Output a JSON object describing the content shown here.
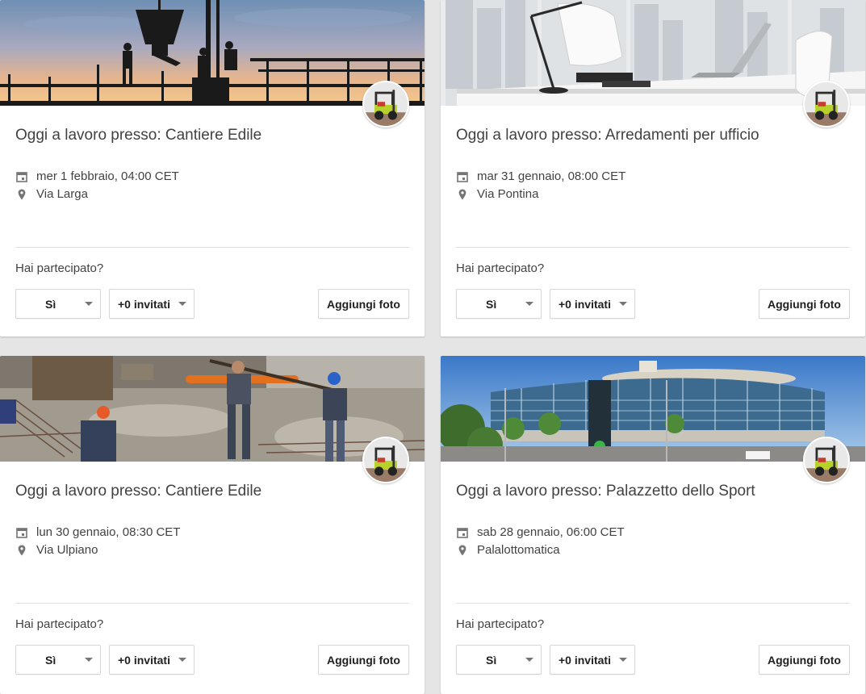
{
  "events": [
    {
      "title": "Oggi a lavoro presso: Cantiere Edile",
      "date": "mer 1 febbraio, 04:00 CET",
      "place": "Via Larga",
      "question": "Hai partecipato?",
      "rsvp": "Sì",
      "guests": "+0 invitati",
      "add_photo": "Aggiungi foto"
    },
    {
      "title": "Oggi a lavoro presso: Arredamenti per ufficio",
      "date": "mar 31 gennaio, 08:00 CET",
      "place": "Via Pontina",
      "question": "Hai partecipato?",
      "rsvp": "Sì",
      "guests": "+0 invitati",
      "add_photo": "Aggiungi foto"
    },
    {
      "title": "Oggi a lavoro presso: Cantiere Edile",
      "date": "lun 30 gennaio, 08:30 CET",
      "place": "Via Ulpiano",
      "question": "Hai partecipato?",
      "rsvp": "Sì",
      "guests": "+0 invitati",
      "add_photo": "Aggiungi foto"
    },
    {
      "title": "Oggi a lavoro presso: Palazzetto dello Sport",
      "date": "sab 28 gennaio, 06:00 CET",
      "place": "Palalottomatica",
      "question": "Hai partecipato?",
      "rsvp": "Sì",
      "guests": "+0 invitati",
      "add_photo": "Aggiungi foto"
    }
  ],
  "icons": {
    "date": "calendar-icon",
    "place": "location-pin-icon",
    "dropdown": "caret-down-icon",
    "avatar": "forklift-avatar"
  },
  "colors": {
    "background": "#e5e5e5",
    "card": "#ffffff",
    "text": "#424242",
    "divider": "#e0e0e0",
    "icon": "#757575"
  }
}
